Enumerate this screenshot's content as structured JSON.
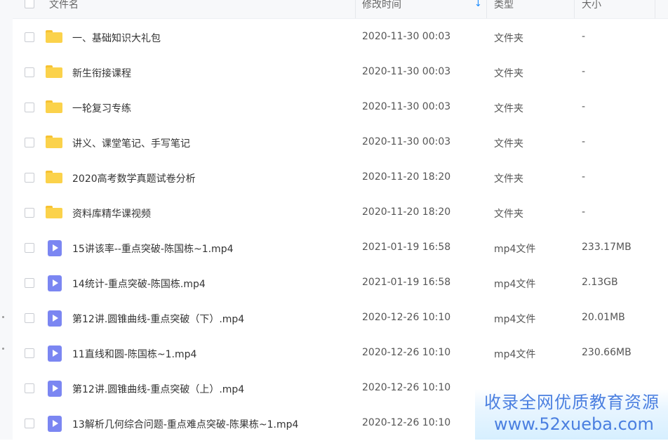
{
  "columns": {
    "name": "文件名",
    "modified": "修改时间",
    "type": "类型",
    "size": "大小"
  },
  "rows": [
    {
      "name": "一、基础知识大礼包",
      "modified": "2020-11-30 00:03",
      "type": "文件夹",
      "size": "-",
      "icon": "folder-icon"
    },
    {
      "name": "新生衔接课程",
      "modified": "2020-11-30 00:03",
      "type": "文件夹",
      "size": "-",
      "icon": "folder-icon"
    },
    {
      "name": "一轮复习专练",
      "modified": "2020-11-30 00:03",
      "type": "文件夹",
      "size": "-",
      "icon": "folder-icon"
    },
    {
      "name": "讲义、课堂笔记、手写笔记",
      "modified": "2020-11-30 00:03",
      "type": "文件夹",
      "size": "-",
      "icon": "folder-icon"
    },
    {
      "name": "2020高考数学真题试卷分析",
      "modified": "2020-11-20 18:20",
      "type": "文件夹",
      "size": "-",
      "icon": "folder-icon"
    },
    {
      "name": "资料库精华课视频",
      "modified": "2020-11-20 18:20",
      "type": "文件夹",
      "size": "-",
      "icon": "folder-icon"
    },
    {
      "name": "15讲该率--重点突破-陈国栋~1.mp4",
      "modified": "2021-01-19 16:58",
      "type": "mp4文件",
      "size": "233.17MB",
      "icon": "video-file-icon"
    },
    {
      "name": "14统计-重点突破-陈国栋.mp4",
      "modified": "2021-01-19 16:58",
      "type": "mp4文件",
      "size": "2.13GB",
      "icon": "video-file-icon"
    },
    {
      "name": "第12讲.圆锥曲线-重点突破（下）.mp4",
      "modified": "2020-12-26 10:10",
      "type": "mp4文件",
      "size": "20.01MB",
      "icon": "video-file-icon"
    },
    {
      "name": "11直线和圆-陈国栋~1.mp4",
      "modified": "2020-12-26 10:10",
      "type": "mp4文件",
      "size": "230.66MB",
      "icon": "video-file-icon"
    },
    {
      "name": "第12讲.圆锥曲线-重点突破（上）.mp4",
      "modified": "2020-12-26 10:10",
      "type": "",
      "size": "",
      "icon": "video-file-icon"
    },
    {
      "name": "13解析几何综合问题-重点难点突破-陈果栋~1.mp4",
      "modified": "2020-12-26 10:10",
      "type": "",
      "size": "",
      "icon": "video-file-icon"
    }
  ],
  "sort_indicator": "↓",
  "watermark": {
    "line1": "收录全网优质教育资源",
    "line2": "www.52xueba.com"
  },
  "colors": {
    "accent": "#1a8cff",
    "folder": "#fbd24b",
    "video": "#7b86f2",
    "watermark": "#4a7fe0"
  }
}
